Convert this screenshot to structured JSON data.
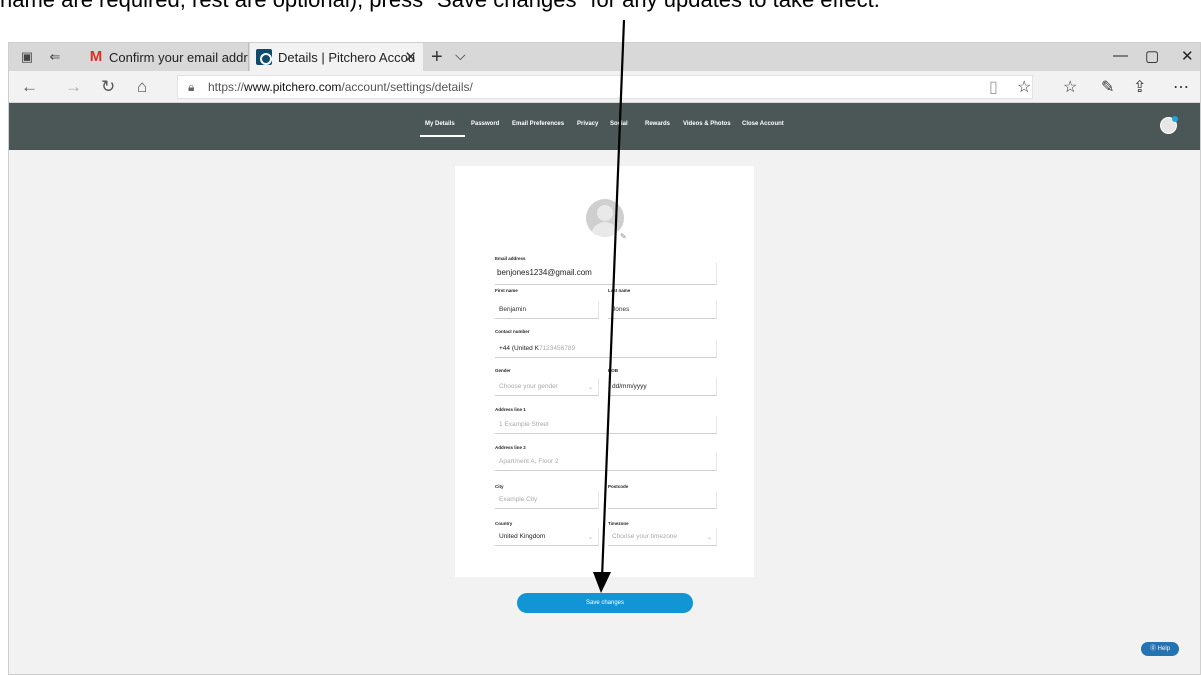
{
  "caption": "name are required, rest are optional), press \"Save changes\" for any updates to take effect.",
  "tabs": [
    {
      "title": "Confirm your email address",
      "icon": "gmail-icon"
    },
    {
      "title": "Details | Pitchero Accou",
      "icon": "pitchero-icon"
    }
  ],
  "address": {
    "prefix": "https://",
    "host": "www.pitchero.com",
    "path": "/account/settings/details/"
  },
  "nav": {
    "links": [
      "My Details",
      "Password",
      "Email Preferences",
      "Privacy",
      "Social",
      "Rewards",
      "Videos & Photos",
      "Close Account"
    ],
    "active": "My Details"
  },
  "form": {
    "email_label": "Email address",
    "email_value": "benjones1234@gmail.com",
    "first_name_label": "First name",
    "first_name_value": "Benjamin",
    "last_name_label": "Last name",
    "last_name_value": "Jones",
    "contact_label": "Contact number",
    "contact_code": "+44 (United K",
    "contact_placeholder": "7123456789",
    "gender_label": "Gender",
    "gender_placeholder": "Choose your gender",
    "dob_label": "DOB",
    "dob_placeholder": "dd/mm/yyyy",
    "address1_label": "Address line 1",
    "address1_placeholder": "1 Example Street",
    "address2_label": "Address line 2",
    "address2_placeholder": "Apartment A, Floor 2",
    "city_label": "City",
    "city_placeholder": "Example City",
    "postcode_label": "Postcode",
    "country_label": "Country",
    "country_value": "United Kingdom",
    "timezone_label": "Timezone",
    "timezone_placeholder": "Choose your timezone"
  },
  "save_label": "Save changes",
  "help_label": "⓪ Help"
}
